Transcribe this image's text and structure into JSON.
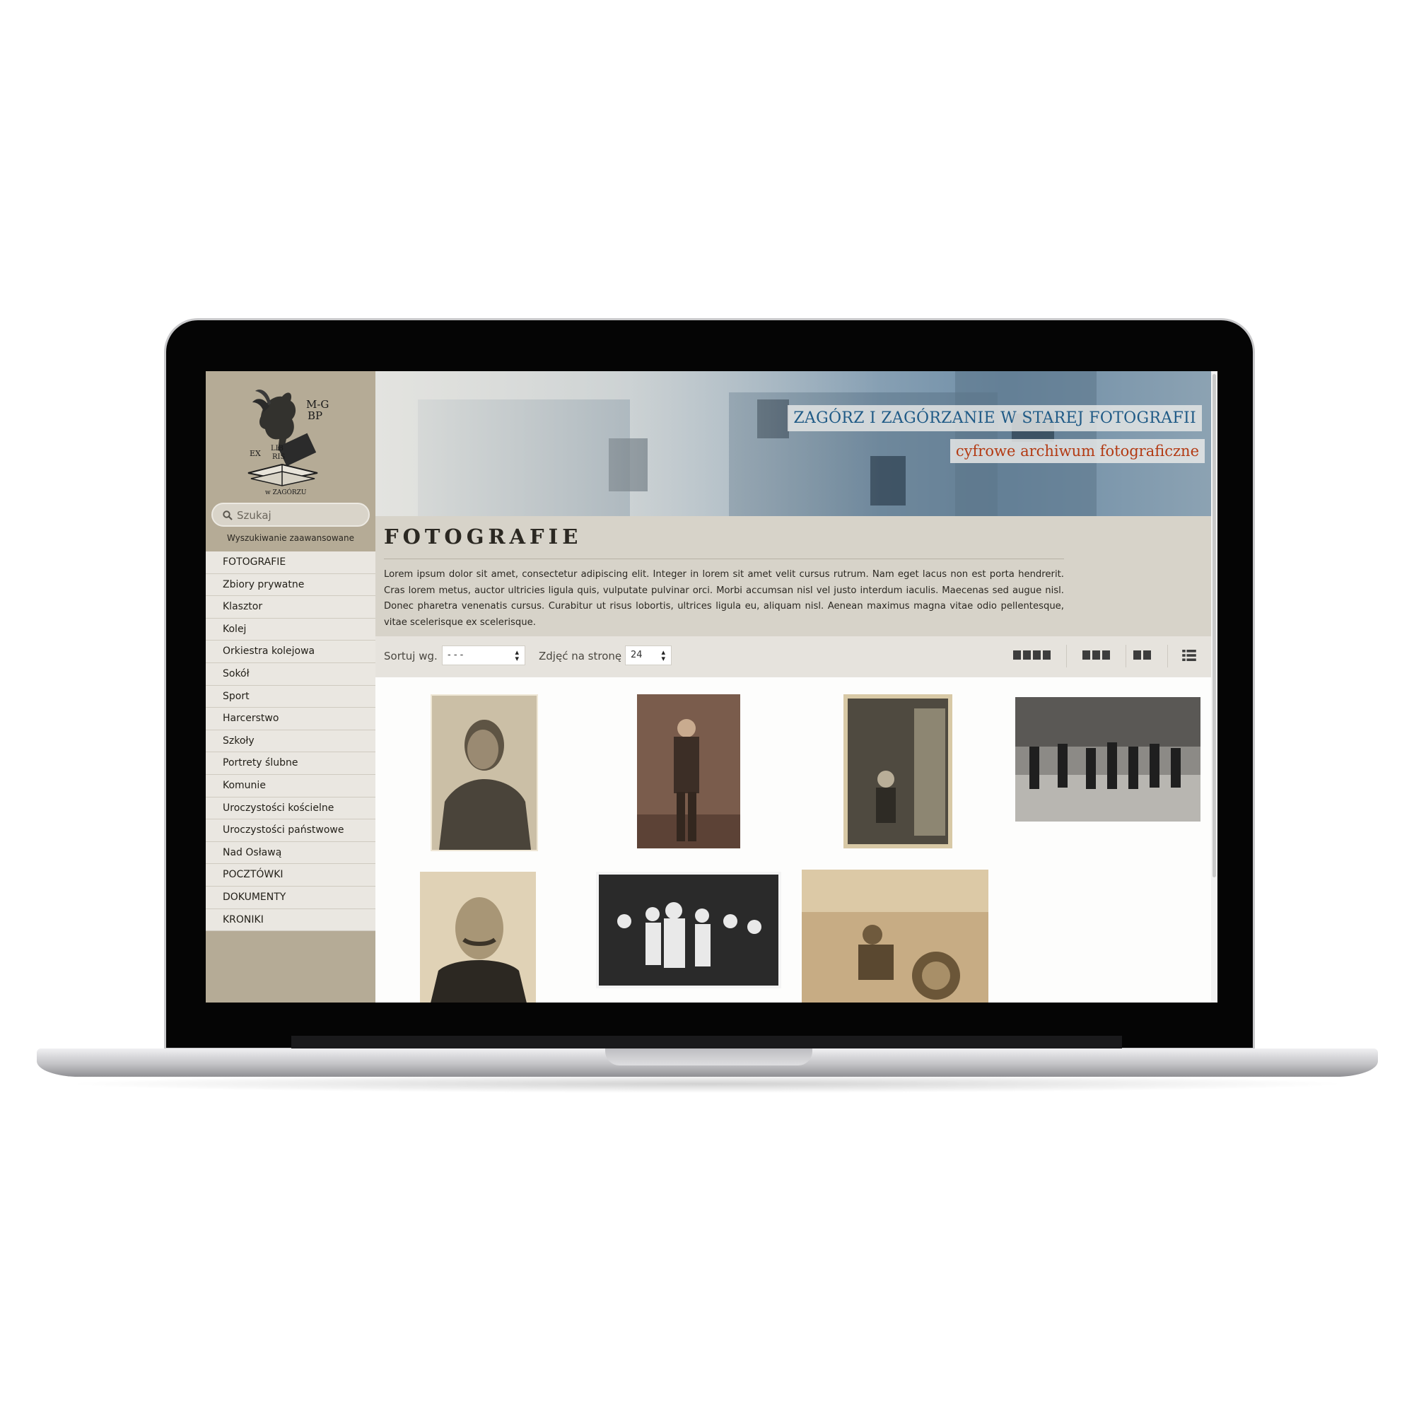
{
  "header": {
    "site_title": "ZAGÓRZ I ZAGÓRZANIE W STAREJ FOTOGRAFII",
    "site_subtitle": "cyfrowe archiwum fotograficzne"
  },
  "logo": {
    "line1": "M-G",
    "line2": "BP",
    "ex": "EX",
    "lib": "LIB",
    "ris": "RIS",
    "bottom": "w ZAGÓRZU"
  },
  "search": {
    "placeholder": "Szukaj",
    "advanced_label": "Wyszukiwanie zaawansowane"
  },
  "sidebar": {
    "items": [
      {
        "label": "FOTOGRAFIE"
      },
      {
        "label": "Zbiory prywatne"
      },
      {
        "label": "Klasztor"
      },
      {
        "label": "Kolej"
      },
      {
        "label": "Orkiestra kolejowa"
      },
      {
        "label": "Sokół"
      },
      {
        "label": "Sport"
      },
      {
        "label": "Harcerstwo"
      },
      {
        "label": "Szkoły"
      },
      {
        "label": "Portrety ślubne"
      },
      {
        "label": "Komunie"
      },
      {
        "label": "Uroczystości kościelne"
      },
      {
        "label": "Uroczystości państwowe"
      },
      {
        "label": "Nad Osławą"
      },
      {
        "label": "POCZTÓWKI"
      },
      {
        "label": "DOKUMENTY"
      },
      {
        "label": "KRONIKI"
      }
    ]
  },
  "main": {
    "title": "FOTOGRAFIE",
    "intro": "Lorem ipsum dolor sit amet, consectetur adipiscing elit. Integer in lorem sit amet velit cursus rutrum. Nam eget lacus non est porta hendrerit. Cras lorem metus, auctor ultricies ligula quis, vulputate pulvinar orci. Morbi accumsan nisl vel justo interdum iaculis. Maecenas sed augue nisl. Donec pharetra venenatis cursus. Curabitur ut risus lobortis, ultrices ligula eu, aliquam nisl. Aenean maximus magna vitae odio pellentesque, vitae scelerisque ex scelerisque."
  },
  "toolbar": {
    "sort_label": "Sortuj wg.",
    "sort_value": "- - -",
    "per_page_label": "Zdjęć na stronę",
    "per_page_value": "24",
    "view_modes": [
      "grid-4-icon",
      "grid-3-icon",
      "grid-2-icon",
      "list-icon"
    ]
  },
  "colors": {
    "sidebar_bg": "#b5ab96",
    "title_blue": "#1f5a86",
    "subtitle_red": "#b33a13",
    "intro_bg": "#d7d3c9"
  }
}
